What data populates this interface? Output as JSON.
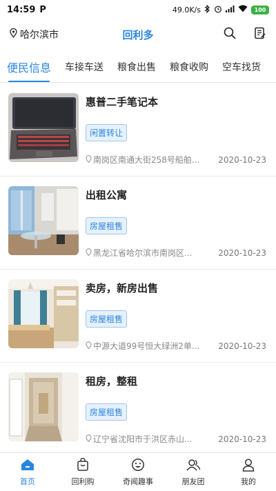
{
  "status": {
    "time": "14:59",
    "badge": "P",
    "speed": "49.0K/s",
    "battery": "100"
  },
  "header": {
    "location": "哈尔滨市",
    "title": "回利多"
  },
  "tabs": [
    {
      "label": "便民信息",
      "active": true
    },
    {
      "label": "车接车送"
    },
    {
      "label": "粮食出售"
    },
    {
      "label": "粮食收购"
    },
    {
      "label": "空车找货"
    }
  ],
  "items": [
    {
      "title": "惠普二手笔记本",
      "tag": "闲置转让",
      "address": "南岗区南通大街258号船舶...",
      "date": "2020-10-23",
      "thumb": "laptop-photo"
    },
    {
      "title": "出租公寓",
      "tag": "房屋租售",
      "address": "黑龙江省哈尔滨市南岗区...",
      "date": "2020-10-23",
      "thumb": "apartment-photo"
    },
    {
      "title": "卖房，新房出售",
      "tag": "房屋租售",
      "address": "中源大道99号恒大绿洲2单...",
      "date": "2020-10-23",
      "thumb": "bedroom-photo"
    },
    {
      "title": "租房，整租",
      "tag": "房屋租售",
      "address": "辽宁省沈阳市于洪区赤山...",
      "date": "2020-10-23",
      "thumb": "hallway-photo"
    }
  ],
  "nav": [
    {
      "label": "首页",
      "icon": "home-icon",
      "active": true
    },
    {
      "label": "回利购",
      "icon": "shopping-bag-icon"
    },
    {
      "label": "奇闻趣事",
      "icon": "smiley-icon"
    },
    {
      "label": "朋友团",
      "icon": "friends-icon"
    },
    {
      "label": "我的",
      "icon": "user-icon"
    }
  ],
  "colors": {
    "accent": "#2a86e0",
    "tag_bg": "#e6f1fc",
    "battery": "#3cb043"
  }
}
